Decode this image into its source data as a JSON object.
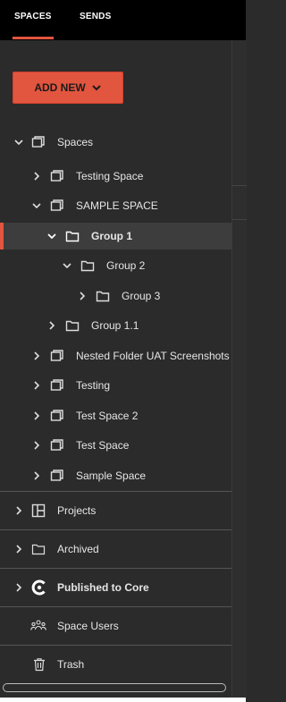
{
  "tabs": [
    {
      "label": "SPACES",
      "active": true
    },
    {
      "label": "SENDS",
      "active": false
    }
  ],
  "add_new": {
    "label": "ADD NEW"
  },
  "tree": {
    "root": "Spaces",
    "items": [
      {
        "label": "Testing Space"
      },
      {
        "label": "SAMPLE SPACE"
      },
      {
        "label": "Group 1"
      },
      {
        "label": "Group 2"
      },
      {
        "label": "Group 3"
      },
      {
        "label": "Group 1.1"
      },
      {
        "label": "Nested Folder UAT Screenshots"
      },
      {
        "label": "Testing"
      },
      {
        "label": "Test Space 2"
      },
      {
        "label": "Test Space"
      },
      {
        "label": "Sample Space"
      }
    ]
  },
  "sections": [
    {
      "label": "Projects"
    },
    {
      "label": "Archived"
    },
    {
      "label": "Published to Core"
    },
    {
      "label": "Space Users"
    },
    {
      "label": "Trash"
    }
  ],
  "colors": {
    "accent": "#e2553f",
    "background": "#2b2b2b",
    "topbar": "#000000"
  }
}
